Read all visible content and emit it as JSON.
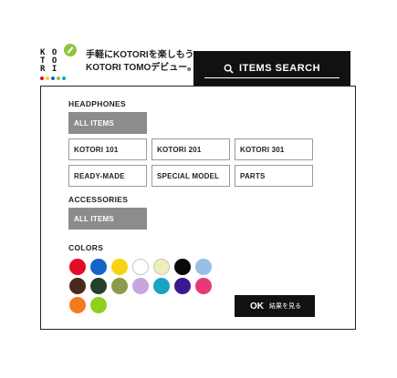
{
  "header": {
    "logo_text": "KOTORI",
    "tagline_line1": "手軽にKOTORIを楽しもう!",
    "tagline_line2": "KOTORI TOMOデビュー。",
    "search_button": "ITEMS SEARCH",
    "search_icon": "search-icon"
  },
  "filters": {
    "headphones_label": "HEADPHONES",
    "headphones_all": "ALL ITEMS",
    "headphones_options": [
      "KOTORI 101",
      "KOTORI 201",
      "KOTORI 301",
      "READY-MADE",
      "SPECIAL MODEL",
      "PARTS"
    ],
    "accessories_label": "ACCESSORIES",
    "accessories_all": "ALL ITEMS",
    "colors_label": "COLORS",
    "colors": [
      "#e30b26",
      "#1565c8",
      "#f7d312",
      "#ffffff",
      "#eeeeb8",
      "#0a0a0a",
      "#98bfe6",
      "#4a2a1a",
      "#244029",
      "#8a9c4a",
      "#c7a5e0",
      "#19a4c4",
      "#3c1891",
      "#e8387a",
      "#f47a1f",
      "#8fcf20"
    ]
  },
  "ok_button": {
    "label": "OK",
    "sub_label": "結果を見る"
  }
}
